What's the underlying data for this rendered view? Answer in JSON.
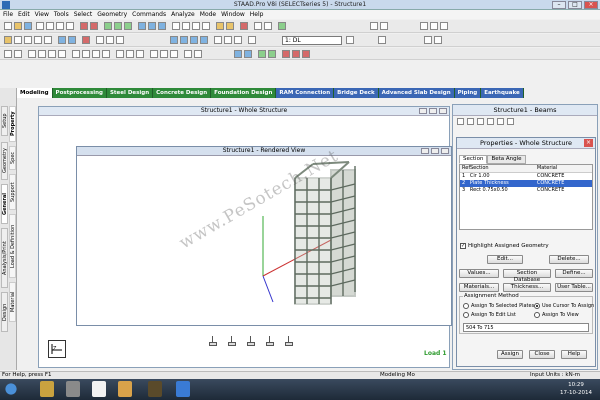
{
  "window": {
    "title": "STAAD.Pro V8i (SELECTseries 5) - Structure1"
  },
  "menubar": {
    "items": [
      "File",
      "Edit",
      "View",
      "Tools",
      "Select",
      "Geometry",
      "Commands",
      "Analyze",
      "Mode",
      "Window",
      "Help"
    ]
  },
  "toolbar": {
    "load_case": "1: DL"
  },
  "mode_tabs": [
    {
      "label": "Modeling"
    },
    {
      "label": "Postprocessing"
    },
    {
      "label": "Steel Design"
    },
    {
      "label": "Concrete Design"
    },
    {
      "label": "Foundation Design"
    },
    {
      "label": "RAM Connection"
    },
    {
      "label": "Bridge Deck"
    },
    {
      "label": "Advanced Slab Design"
    },
    {
      "label": "Piping"
    },
    {
      "label": "Earthquake"
    }
  ],
  "sidebar": {
    "outer": [
      "Setup",
      "Geometry",
      "General",
      "Analysis/Print",
      "Design"
    ],
    "inner": [
      "Property",
      "Spec",
      "Support",
      "Load & Definition",
      "Material"
    ]
  },
  "main_window": {
    "title": "Structure1 - Whole Structure"
  },
  "rendered_view": {
    "title": "Structure1 - Rendered View"
  },
  "view": {
    "load_label": "Load 1",
    "watermark": "www.PeSotech.Net",
    "axis_label": "Z"
  },
  "beams_panel": {
    "title": "Structure1 - Beams"
  },
  "properties": {
    "title": "Properties - Whole Structure",
    "tabs": [
      {
        "label": "Section"
      },
      {
        "label": "Beta Angle"
      }
    ],
    "columns": {
      "ref": "Ref",
      "section": "Section",
      "material": "Material"
    },
    "rows": [
      {
        "ref": "1",
        "section": "Cir 1.00",
        "material": "CONCRETE"
      },
      {
        "ref": "2",
        "section": "Plate Thickness",
        "material": "CONCRETE"
      },
      {
        "ref": "3",
        "section": "Rect 0.75x0.50",
        "material": "CONCRETE"
      }
    ],
    "highlight_label": "Highlight Assigned Geometry",
    "buttons": {
      "edit": "Edit...",
      "delete": "Delete...",
      "values": "Values...",
      "section_database": "Section Database",
      "define": "Define...",
      "materials": "Materials...",
      "thickness": "Thickness...",
      "user_table": "User Table..."
    },
    "assignment_method": {
      "label": "Assignment Method",
      "to_selected": "Assign To Selected Plates",
      "use_cursor": "Use Cursor To Assign",
      "edit_list": "Assign To Edit List",
      "to_view": "Assign To View",
      "edit_list_value": "504 To 715"
    },
    "footer": {
      "assign": "Assign",
      "close": "Close",
      "help": "Help"
    }
  },
  "statusbar": {
    "help": "For Help, press F1",
    "mode": "Modeling Mo",
    "units": "Input Units : kN-m"
  },
  "taskbar": {
    "time": "10:29",
    "date": "17-10-2014"
  }
}
